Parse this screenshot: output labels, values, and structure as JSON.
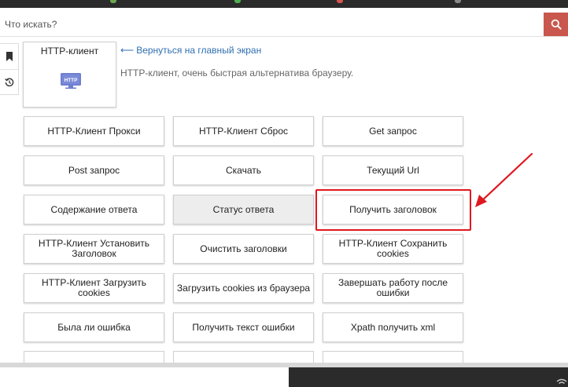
{
  "search": {
    "placeholder": "Что искать?"
  },
  "module": {
    "title": "HTTP-клиент",
    "icon_label": "HTTP",
    "back_link": "Вернуться на главный экран",
    "description": "HTTP-клиент, очень быстрая альтернатива браузеру."
  },
  "commands": [
    "HTTP-Клиент Прокси",
    "HTTP-Клиент Сброс",
    "Get запрос",
    "Post запрос",
    "Скачать",
    "Текущий Url",
    "Содержание ответа",
    "Статус ответа",
    "Получить заголовок",
    "HTTP-Клиент Установить Заголовок",
    "Очистить заголовки",
    "HTTP-Клиент Сохранить cookies",
    "HTTP-Клиент Загрузить cookies",
    "Загрузить cookies из браузера",
    "Завершать работу после ошибки",
    "Была ли ошибка",
    "Получить текст ошибки",
    "Xpath получить xml"
  ],
  "highlighted_command": "Получить заголовок",
  "hovered_command": "Статус ответа",
  "colors": {
    "accent_search": "#c9574e",
    "link": "#2f6fb0",
    "highlight": "#e0171f",
    "icon_purple": "#6f7fd0"
  }
}
